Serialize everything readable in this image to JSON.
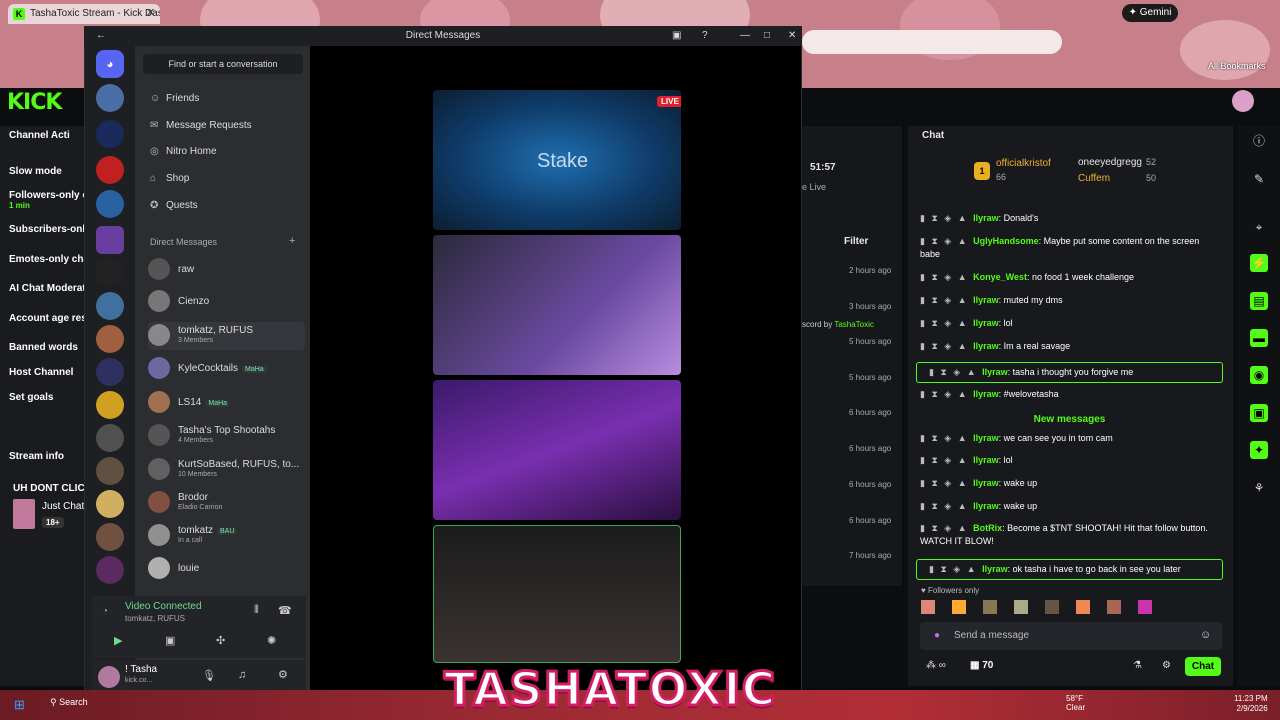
{
  "browser": {
    "tab_title": "TashaToxic Stream - Kick Dashb",
    "gemini": "Gemini",
    "all_bookmarks": "All Bookmarks"
  },
  "kick": {
    "logo": "KICK",
    "channel_actions_title": "Channel Acti",
    "actions": [
      "Slow mode",
      "Followers-only c",
      "Subscribers-onl",
      "Emotes-only cha",
      "AI Chat Moderat",
      "Account age res",
      "Banned words",
      "Host Channel",
      "Set goals"
    ],
    "followers_sub": "1 min",
    "stream_info": "Stream info",
    "stream_title": "UH DONT CLICI",
    "stream_category": "Just Chat",
    "age_badge": "18+",
    "timer": "51:57",
    "live_text": "e Live",
    "filter": "Filter",
    "activity_times": [
      "2 hours ago",
      "3 hours ago",
      "5 hours ago",
      "5 hours ago",
      "6 hours ago",
      "6 hours ago",
      "6 hours ago",
      "6 hours ago",
      "7 hours ago"
    ],
    "activity_note": "scord by",
    "activity_user": "TashaToxic",
    "chat": {
      "title": "Chat",
      "top1_rank": "1",
      "top1_name": "officialkristof",
      "top1_count": "66",
      "top2_name": "oneeyedgregg",
      "top2_count": "52",
      "top3_name": "Cuffem",
      "top3_count": "50",
      "messages": [
        {
          "user": "llyraw",
          "text": "Donald's"
        },
        {
          "user": "UglyHandsome",
          "text": "Maybe put some content on the screen babe"
        },
        {
          "user": "Konye_West",
          "text": "no food 1 week challenge"
        },
        {
          "user": "llyraw",
          "text": "muted my dms"
        },
        {
          "user": "llyraw",
          "text": "lol"
        },
        {
          "user": "llyraw",
          "text": "Im a real savage"
        },
        {
          "user": "llyraw",
          "text": "tasha i thought you forgive me"
        },
        {
          "user": "llyraw",
          "text": "#welovetasha"
        },
        {
          "user": "llyraw",
          "text": "we can see you in tom cam"
        },
        {
          "user": "llyraw",
          "text": "lol"
        },
        {
          "user": "llyraw",
          "text": "wake up"
        },
        {
          "user": "llyraw",
          "text": "wake up"
        },
        {
          "user": "BotRix",
          "text": "Become a $TNT SHOOTAH! Hit that follow button. WATCH IT BLOW!"
        },
        {
          "user": "llyraw",
          "text": "ok tasha i have to go back in see you later"
        }
      ],
      "new_messages": "New messages",
      "followers_only": "Followers only",
      "placeholder": "Send a message",
      "points": "70",
      "send": "Chat"
    }
  },
  "discord": {
    "title": "Direct Messages",
    "find": "Find or start a conversation",
    "nav": [
      "Friends",
      "Message Requests",
      "Nitro Home",
      "Shop",
      "Quests"
    ],
    "dm_header": "Direct Messages",
    "dms": [
      {
        "name": "raw",
        "sub": ""
      },
      {
        "name": "Cienzo",
        "sub": ""
      },
      {
        "name": "tomkatz, RUFUS",
        "sub": "3 Members"
      },
      {
        "name": "KyleCocktails",
        "sub": "",
        "tag": "MaHa"
      },
      {
        "name": "LS14",
        "sub": "",
        "tag": "MaHa"
      },
      {
        "name": "Tasha's Top Shootahs",
        "sub": "4 Members"
      },
      {
        "name": "KurtSoBased, RUFUS, to...",
        "sub": "10 Members"
      },
      {
        "name": "Brodor",
        "sub": "Eladio Carrion"
      },
      {
        "name": "tomkatz",
        "sub": "In a call",
        "tag": "BAU"
      },
      {
        "name": "louie",
        "sub": ""
      }
    ],
    "voice_status": "Video Connected",
    "voice_channel": "tomkatz, RUFUS",
    "user_name": "! Tasha",
    "user_sub": "kick.co...",
    "live_badge": "LIVE",
    "stake": "Stake"
  },
  "taskbar": {
    "search": "Search",
    "temp": "58°F",
    "weather": "Clear",
    "time": "11:23 PM",
    "date": "2/9/2026"
  },
  "overlay": "TASHATOXIC",
  "colors": {
    "kick_green": "#53fc18",
    "discord_bg": "#1e1f22",
    "overlay_pink": "#d21e64"
  }
}
